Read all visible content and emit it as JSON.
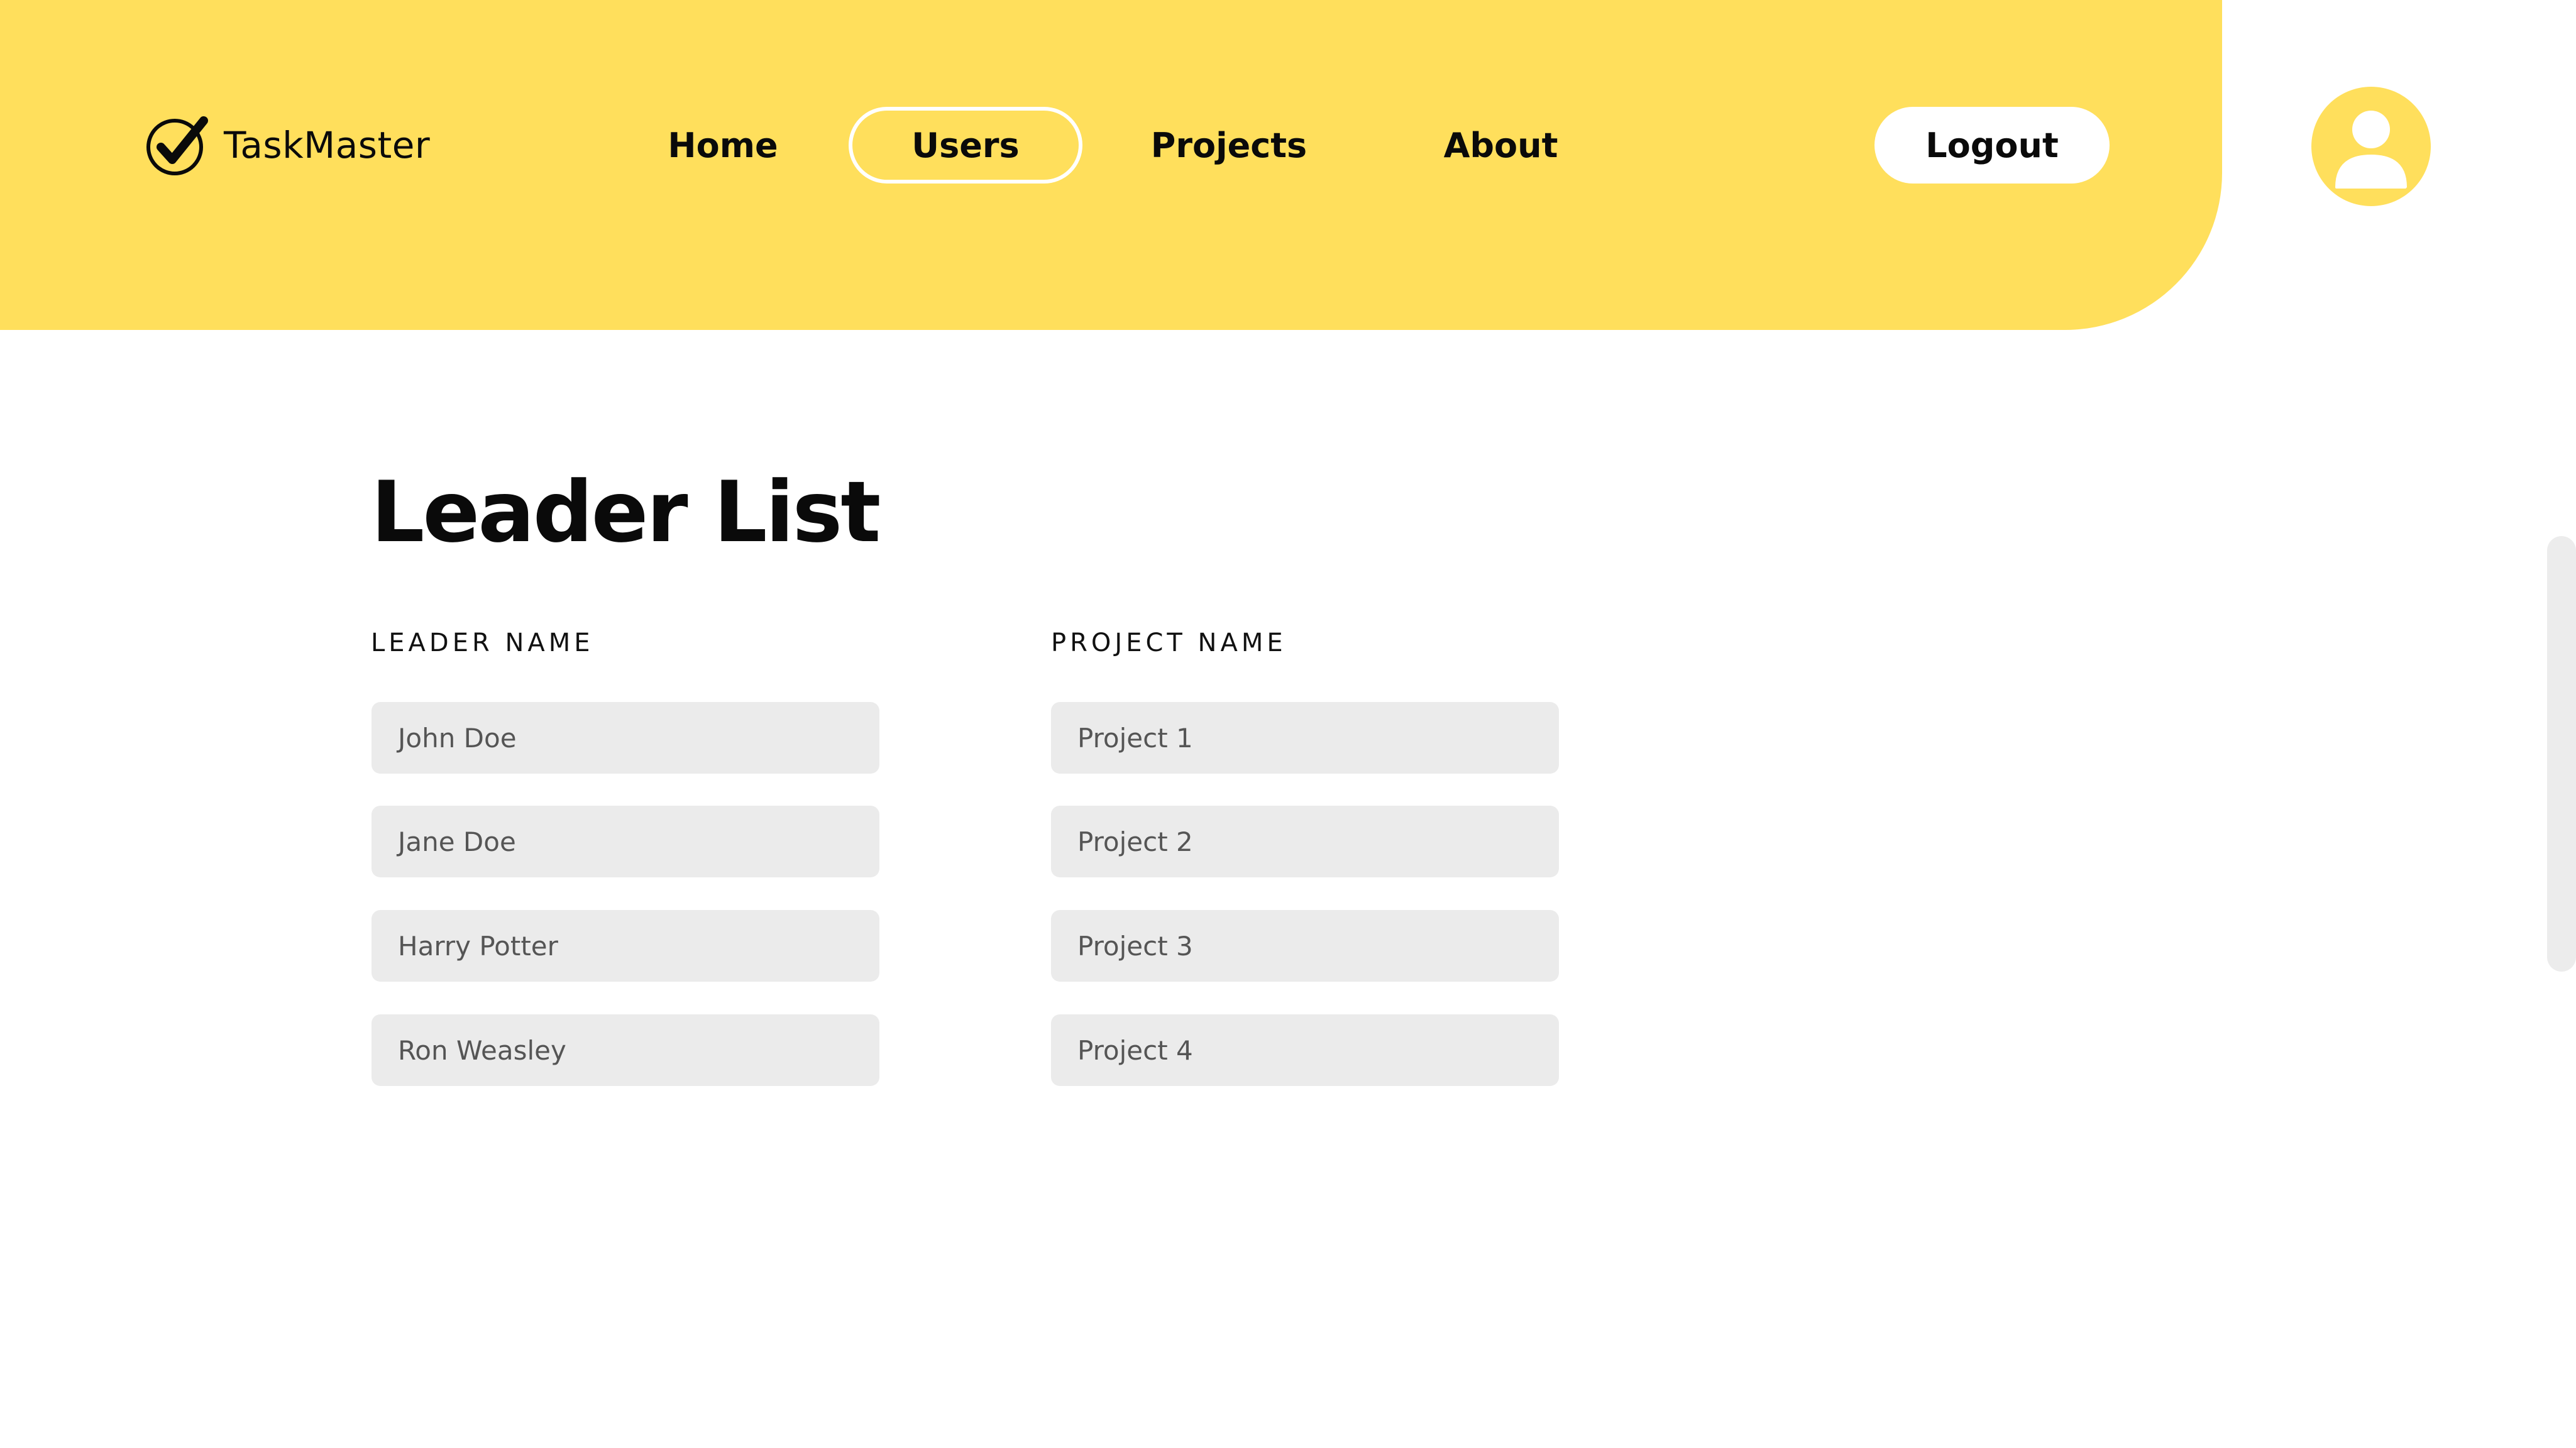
{
  "app": {
    "name": "TaskMaster",
    "logo_icon": "check-circle-icon",
    "accent_color": "#ffdf5c"
  },
  "nav": {
    "items": [
      {
        "label": "Home",
        "active": false
      },
      {
        "label": "Users",
        "active": true
      },
      {
        "label": "Projects",
        "active": false
      },
      {
        "label": "About",
        "active": false
      }
    ],
    "logout_label": "Logout",
    "avatar_icon": "user-icon"
  },
  "main": {
    "title": "Leader List",
    "columns": {
      "leader": "LEADER NAME",
      "project": "PROJECT NAME"
    },
    "rows": [
      {
        "leader": "John Doe",
        "project": "Project 1"
      },
      {
        "leader": "Jane Doe",
        "project": "Project 2"
      },
      {
        "leader": "Harry Potter",
        "project": "Project 3"
      },
      {
        "leader": "Ron Weasley",
        "project": "Project 4"
      }
    ]
  }
}
